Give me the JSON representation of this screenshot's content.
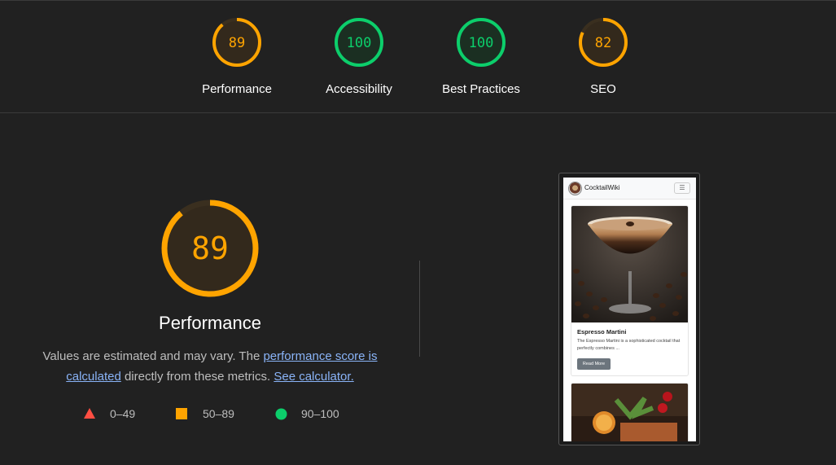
{
  "scores": [
    {
      "label": "Performance",
      "value": 89,
      "status": "average"
    },
    {
      "label": "Accessibility",
      "value": 100,
      "status": "pass"
    },
    {
      "label": "Best Practices",
      "value": 100,
      "status": "pass"
    },
    {
      "label": "SEO",
      "value": 82,
      "status": "average"
    }
  ],
  "colors": {
    "pass": "#0cce6b",
    "average": "#ffa400",
    "fail": "#ff4e42",
    "link": "#8ab4f8",
    "background": "#212121"
  },
  "main": {
    "score": 89,
    "title": "Performance",
    "desc_prefix": "Values are estimated and may vary. The ",
    "desc_link1": "performance score is calculated",
    "desc_mid": " directly from these metrics. ",
    "desc_link2": "See calculator.",
    "legend": [
      {
        "icon": "triangle-icon",
        "range": "0–49"
      },
      {
        "icon": "square-icon",
        "range": "50–89"
      },
      {
        "icon": "circle-icon",
        "range": "90–100"
      }
    ]
  },
  "preview": {
    "brand": "CocktailWiki",
    "card_title": "Espresso Martini",
    "card_text": "The Espresso Martini is a sophisticated cocktail that perfectly combines ...",
    "card_button": "Read More"
  }
}
